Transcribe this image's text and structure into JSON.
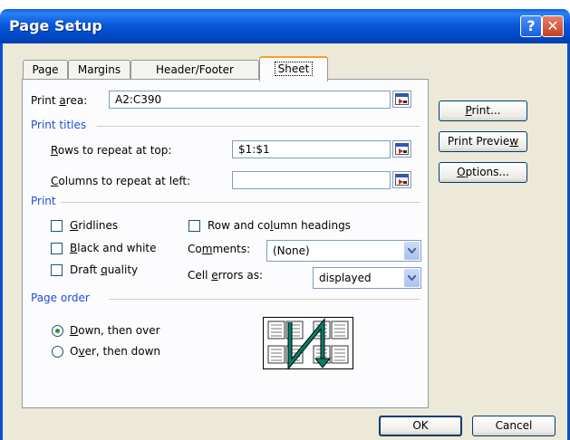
{
  "window": {
    "title": "Page Setup",
    "help_glyph": "?",
    "close_glyph": "✕"
  },
  "tabs": [
    {
      "label": "Page"
    },
    {
      "label": "Margins"
    },
    {
      "label": "Header/Footer"
    },
    {
      "label": "Sheet",
      "active": true
    }
  ],
  "print_area": {
    "label_pre": "Print ",
    "label_u": "a",
    "label_post": "rea:",
    "value": "A2:C390"
  },
  "print_titles": {
    "heading": "Print titles",
    "rows": {
      "label_u": "R",
      "label_post": "ows to repeat at top:",
      "value": "$1:$1"
    },
    "columns": {
      "label_u": "C",
      "label_post": "olumns to repeat at left:",
      "value": ""
    }
  },
  "print": {
    "heading": "Print",
    "gridlines": {
      "label_u": "G",
      "label_post": "ridlines",
      "checked": false
    },
    "black_white": {
      "label_u": "B",
      "label_post": "lack and white",
      "checked": false
    },
    "draft": {
      "label_pre": "Draft ",
      "label_u": "q",
      "label_post": "uality",
      "checked": false
    },
    "headings": {
      "label_pre": "Row and co",
      "label_u": "l",
      "label_post": "umn headings",
      "checked": false
    },
    "comments": {
      "label_pre": "Co",
      "label_u": "m",
      "label_post": "ments:",
      "value": "(None)"
    },
    "cell_errors": {
      "label_pre": "Cell ",
      "label_u": "e",
      "label_post": "rrors as:",
      "value": "displayed"
    }
  },
  "page_order": {
    "heading": "Page order",
    "down_then_over": {
      "label_u": "D",
      "label_post": "own, then over",
      "selected": true
    },
    "over_then_down": {
      "label_pre": "O",
      "label_u": "v",
      "label_post": "er, then down",
      "selected": false
    }
  },
  "buttons": {
    "print": {
      "label_u": "P",
      "label_post": "rint..."
    },
    "print_preview": {
      "label_pre": "Print Previe",
      "label_u": "w",
      "label_post": ""
    },
    "options": {
      "label_u": "O",
      "label_post": "ptions..."
    },
    "ok": "OK",
    "cancel": "Cancel"
  },
  "colors": {
    "title_bar": "#0a58dc",
    "dialog_bg": "#ece9d8",
    "section_text": "#1f4ed2",
    "active_tab_accent": "#f7a21c"
  }
}
